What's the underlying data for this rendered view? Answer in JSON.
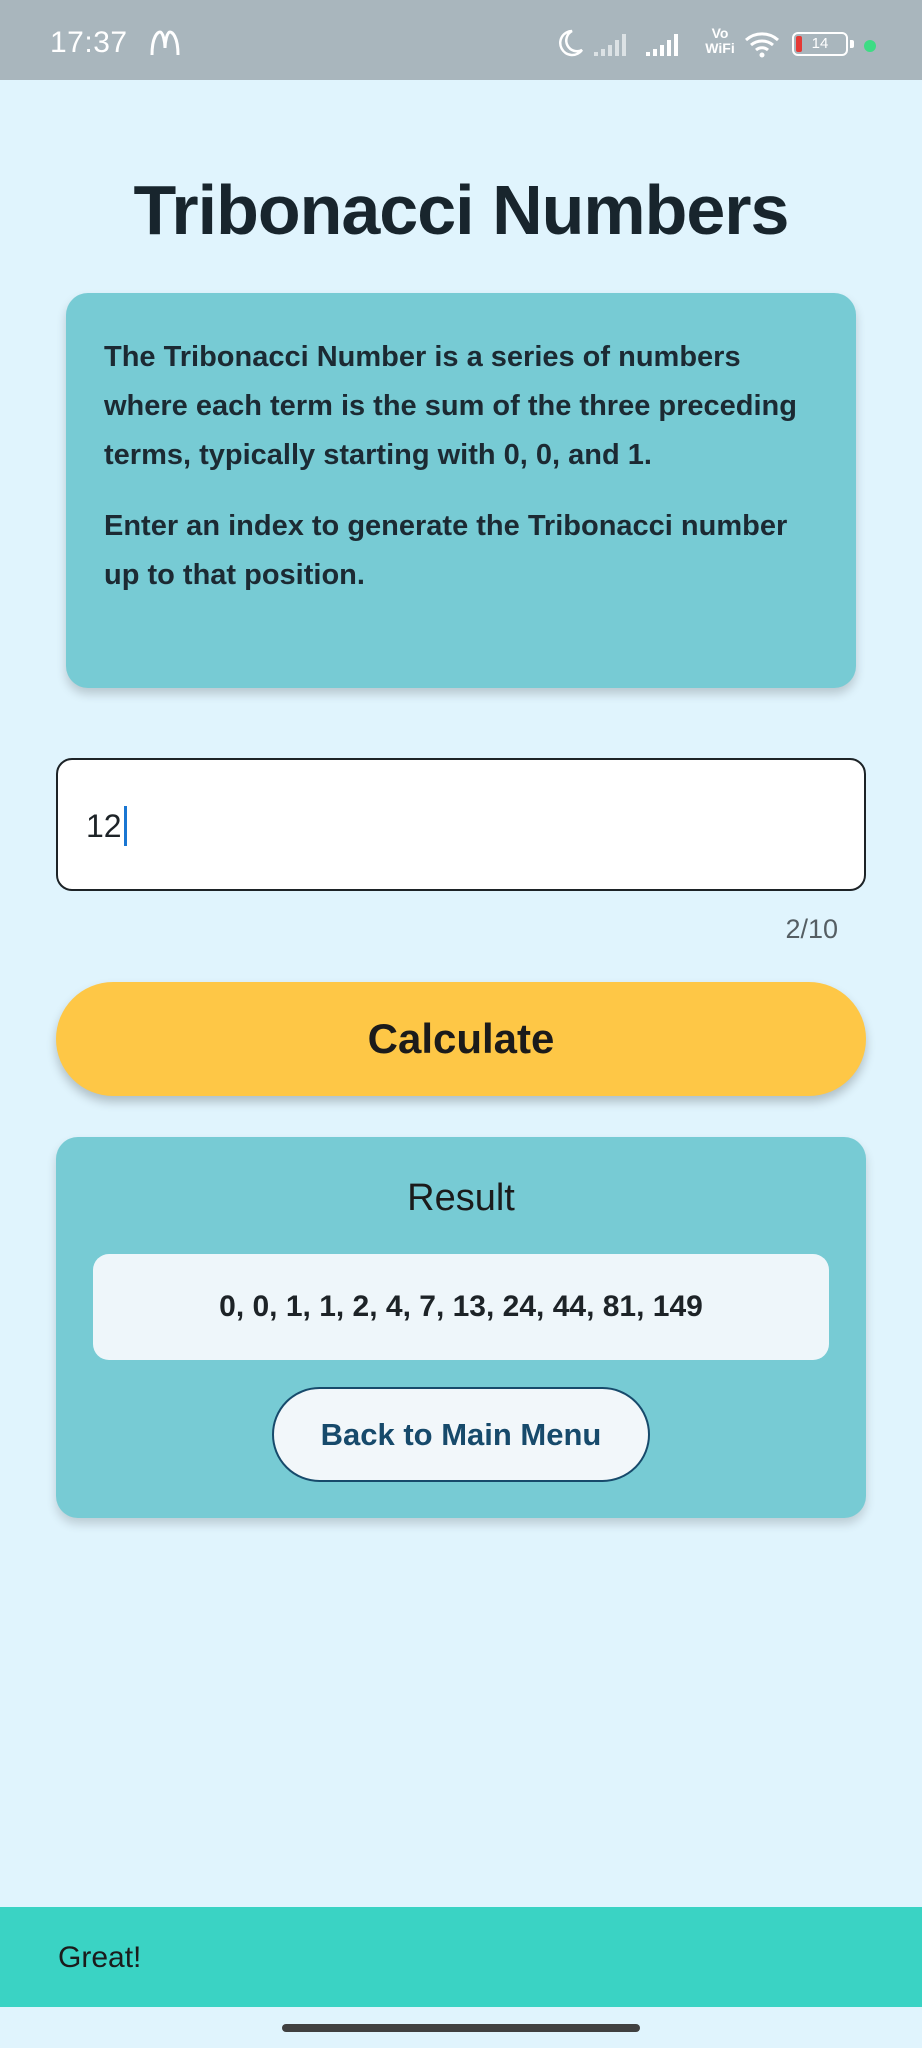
{
  "status_bar": {
    "time": "17:37",
    "vowifi": "Vo\nWiFi",
    "battery_level": "14"
  },
  "page": {
    "title": "Tribonacci Numbers"
  },
  "info_card": {
    "paragraph_1": "The Tribonacci Number is a series of numbers where each term is the sum of the three preceding terms, typically starting with 0, 0, and 1.",
    "paragraph_2": "Enter an index to generate the Tribonacci number up to that position."
  },
  "index_input": {
    "value": "12",
    "counter": "2/10"
  },
  "calculate_button": {
    "label": "Calculate"
  },
  "result_card": {
    "title": "Result",
    "value": "0, 0, 1, 1, 2, 4, 7, 13, 24, 44, 81, 149",
    "back_button_label": "Back to Main Menu"
  },
  "snackbar": {
    "message": "Great!"
  },
  "colors": {
    "background": "#e0f4fd",
    "card": "#77cbd4",
    "calculate_button": "#fec746",
    "snackbar": "#3ad3c4",
    "back_button_text": "#174a6b"
  }
}
